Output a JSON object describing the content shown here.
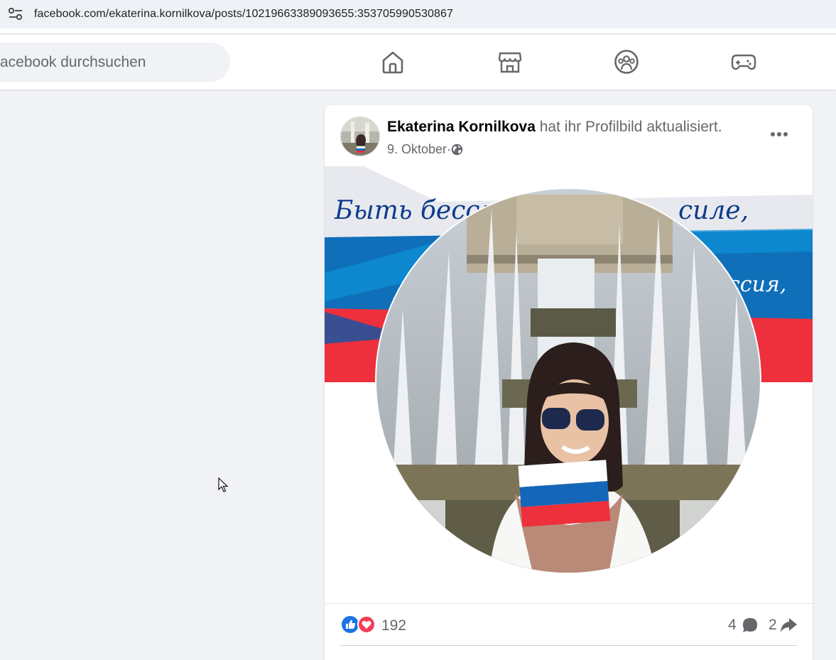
{
  "browser": {
    "url": "facebook.com/ekaterina.kornilkova/posts/10219663389093655:353705990530867",
    "settings_icon": "site-settings-icon"
  },
  "header": {
    "search_placeholder": "acebook durchsuchen",
    "nav_icons": [
      "home-icon",
      "marketplace-icon",
      "groups-icon",
      "gaming-icon"
    ]
  },
  "post": {
    "author": "Ekaterina Kornilkova",
    "action": " hat ihr Profilbild aktualisiert.",
    "date": "9. Oktober",
    "separator": " · ",
    "privacy_icon": "globe-icon",
    "banner_text_1": "Быть бессм",
    "banner_text_1b": "силе,",
    "banner_text_2": "ссия,",
    "reactions": {
      "count": "192",
      "comments": "4",
      "shares": "2"
    }
  },
  "colors": {
    "fb_bg": "#f0f2f5",
    "russia_white": "#f2f2f2",
    "russia_blue": "#1466b8",
    "russia_red": "#ee2f3c",
    "like_blue": "#1b74e4",
    "love_red": "#f33e58"
  }
}
